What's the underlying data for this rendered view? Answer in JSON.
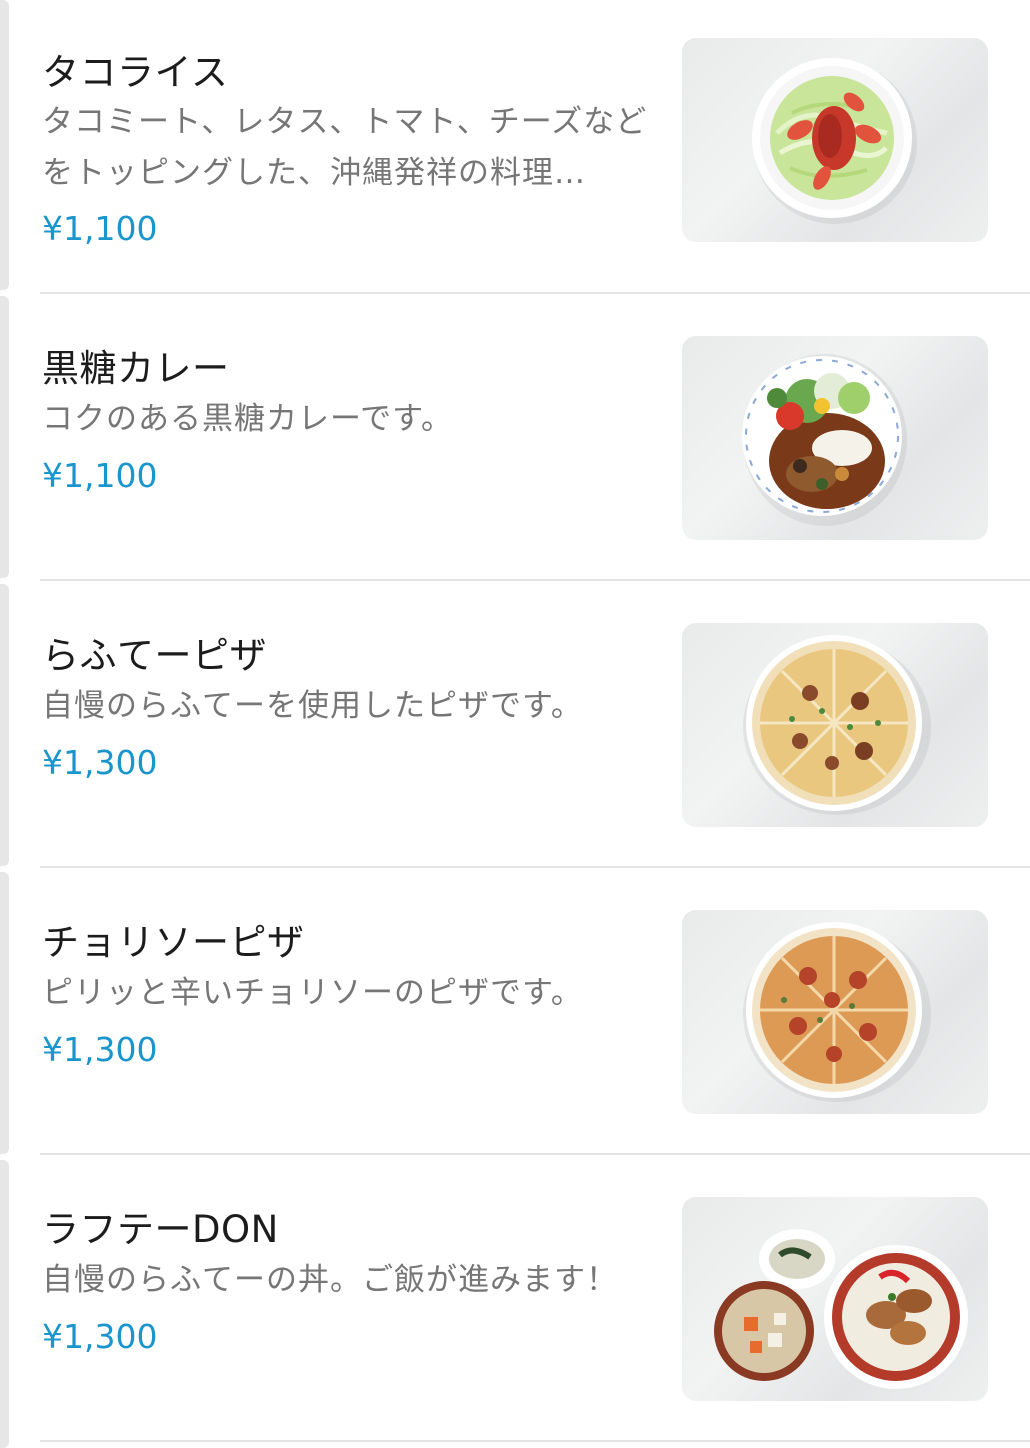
{
  "menu": {
    "items": [
      {
        "name": "タコライス",
        "description": "タコミート、レタス、トマト、チーズなどをトッピングした、沖縄発祥の料理…",
        "price": "¥1,100",
        "photo_icon": "taco-rice-photo"
      },
      {
        "name": "黒糖カレー",
        "description": "コクのある黒糖カレーです。",
        "price": "¥1,100",
        "photo_icon": "kokuto-curry-photo"
      },
      {
        "name": "らふてーピザ",
        "description": "自慢のらふてーを使用したピザです。",
        "price": "¥1,300",
        "photo_icon": "rafute-pizza-photo"
      },
      {
        "name": "チョリソーピザ",
        "description": "ピリッと辛いチョリソーのピザです。",
        "price": "¥1,300",
        "photo_icon": "chorizo-pizza-photo"
      },
      {
        "name": "ラフテーDON",
        "description": "自慢のらふてーの丼。ご飯が進みます！",
        "price": "¥1,300",
        "photo_icon": "rafute-don-photo"
      }
    ]
  },
  "colors": {
    "price": "#1a96cc",
    "name": "#1c1c1c",
    "description": "#767676",
    "divider": "#e4e4e4"
  }
}
